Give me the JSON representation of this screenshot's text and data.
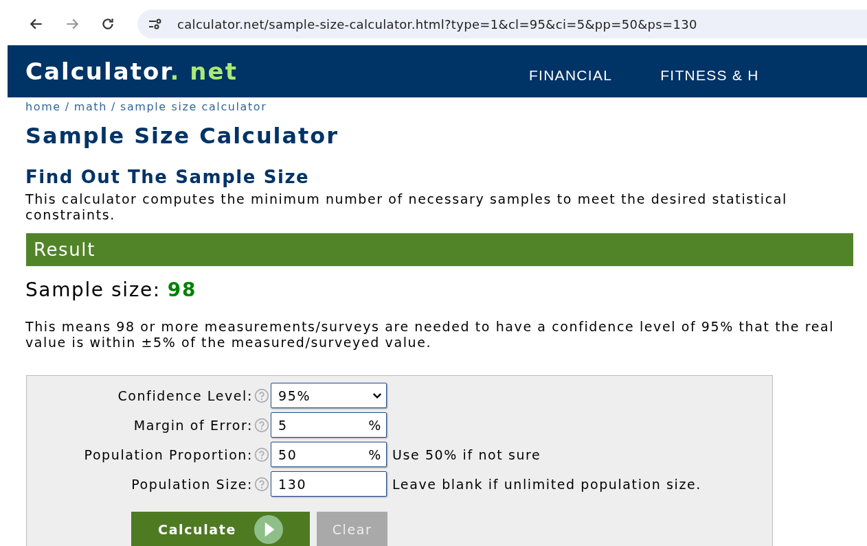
{
  "browser": {
    "url": "calculator.net/sample-size-calculator.html?type=1&cl=95&ci=5&pp=50&ps=130"
  },
  "header": {
    "logo": {
      "name": "Calculator",
      "suffix": ". net"
    },
    "nav": [
      "FINANCIAL",
      "FITNESS & H"
    ]
  },
  "breadcrumbs": {
    "separator": "/",
    "items": [
      "home",
      "math",
      "sample size calculator"
    ]
  },
  "title": "Sample Size Calculator",
  "subtitle": "Find Out The Sample Size",
  "intro": "This calculator computes the minimum number of necessary samples to meet the desired statistical constraints.",
  "result": {
    "heading": "Result",
    "label": "Sample size:",
    "value": "98",
    "explanation": "This means 98 or more measurements/surveys are needed to have a confidence level of 95% that the real value is within ±5% of the measured/surveyed value."
  },
  "form": {
    "fields": [
      {
        "kind": "select",
        "label": "Confidence Level:",
        "value": "95%"
      },
      {
        "kind": "percent",
        "label": "Margin of Error:",
        "value": "5",
        "suffix": "%"
      },
      {
        "kind": "percent",
        "label": "Population Proportion:",
        "value": "50",
        "suffix": "%",
        "hint": "Use 50% if not sure"
      },
      {
        "kind": "number",
        "label": "Population Size:",
        "value": "130",
        "hint": "Leave blank if unlimited population size."
      }
    ],
    "buttons": [
      {
        "kind": "primary",
        "label": "Calculate"
      },
      {
        "kind": "secondary",
        "label": "Clear"
      }
    ]
  }
}
